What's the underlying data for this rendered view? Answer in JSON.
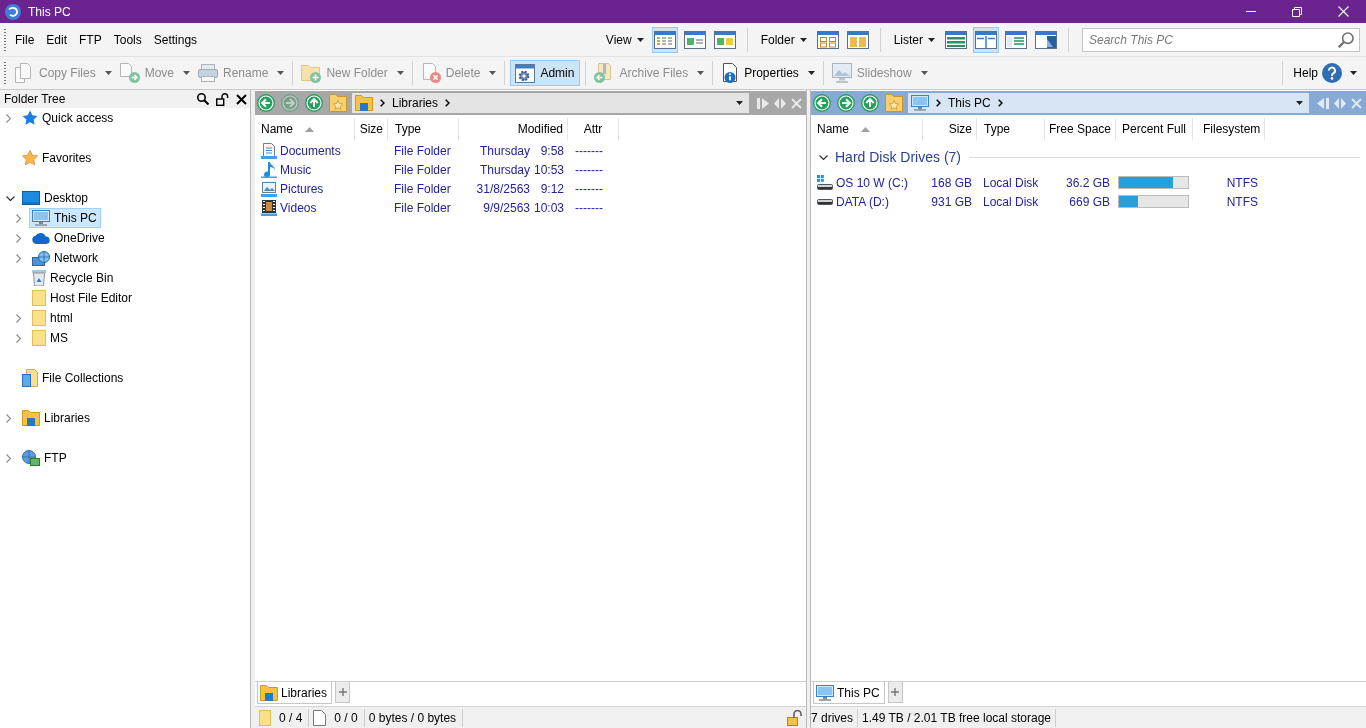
{
  "window": {
    "title": "This PC"
  },
  "menu": [
    {
      "label": "File"
    },
    {
      "label": "Edit"
    },
    {
      "label": "FTP"
    },
    {
      "label": "Tools"
    },
    {
      "label": "Settings"
    }
  ],
  "view_groups": [
    {
      "label": "View",
      "buttons": [
        {
          "kind": "details",
          "selected": true
        },
        {
          "kind": "thumbnails",
          "selected": false
        },
        {
          "kind": "tiles",
          "selected": false
        }
      ]
    },
    {
      "label": "Folder",
      "buttons": [
        {
          "kind": "grid",
          "selected": false
        },
        {
          "kind": "pair",
          "selected": false
        }
      ]
    },
    {
      "label": "Lister",
      "buttons": [
        {
          "kind": "stripes",
          "selected": false
        },
        {
          "kind": "dual",
          "selected": true
        },
        {
          "kind": "tree",
          "selected": false
        },
        {
          "kind": "viewer",
          "selected": false
        }
      ]
    }
  ],
  "search": {
    "placeholder": "Search This PC"
  },
  "toolbar_groups": [
    {
      "buttons": [
        {
          "label": "Copy Files",
          "kind": "copy",
          "disabled": true,
          "on": false,
          "dropdown": true
        },
        {
          "label": "Move",
          "kind": "move",
          "disabled": true,
          "on": false,
          "dropdown": true
        },
        {
          "label": "Rename",
          "kind": "rename",
          "disabled": true,
          "on": false,
          "dropdown": true
        }
      ]
    },
    {
      "buttons": [
        {
          "label": "New Folder",
          "kind": "newfolder",
          "disabled": true,
          "on": false,
          "dropdown": true
        }
      ]
    },
    {
      "buttons": [
        {
          "label": "Delete",
          "kind": "delete",
          "disabled": true,
          "on": false,
          "dropdown": true
        }
      ]
    },
    {
      "buttons": [
        {
          "label": "Admin",
          "kind": "admin",
          "disabled": false,
          "on": true,
          "dropdown": false
        }
      ]
    },
    {
      "buttons": [
        {
          "label": "Archive Files",
          "kind": "archive",
          "disabled": true,
          "on": false,
          "dropdown": true
        }
      ]
    },
    {
      "buttons": [
        {
          "label": "Properties",
          "kind": "properties",
          "disabled": false,
          "on": false,
          "dropdown": true
        }
      ]
    },
    {
      "buttons": [
        {
          "label": "Slideshow",
          "kind": "slideshow",
          "disabled": true,
          "on": false,
          "dropdown": true
        }
      ]
    }
  ],
  "help": {
    "label": "Help"
  },
  "folder_tree": {
    "title": "Folder Tree",
    "items": [
      {
        "label": "Quick access",
        "kind": "pin",
        "selected": false,
        "expanded": false
      },
      {
        "label": "Favorites",
        "kind": "favorites",
        "selected": false
      },
      {
        "label": "Desktop",
        "kind": "desktop",
        "selected": false,
        "expanded": true,
        "children": [
          {
            "label": "This PC",
            "kind": "computer",
            "selected": true,
            "expanded": false
          },
          {
            "label": "OneDrive",
            "kind": "cloud",
            "selected": false,
            "expanded": false
          },
          {
            "label": "Network",
            "kind": "network",
            "selected": false,
            "expanded": false
          },
          {
            "label": "Recycle Bin",
            "kind": "recycle",
            "selected": false
          },
          {
            "label": "Host File Editor",
            "kind": "folder",
            "selected": false
          },
          {
            "label": "html",
            "kind": "folder",
            "selected": false,
            "expanded": false
          },
          {
            "label": "MS",
            "kind": "folder",
            "selected": false,
            "expanded": false
          }
        ]
      },
      {
        "label": "File Collections",
        "kind": "collections",
        "selected": false
      },
      {
        "label": "Libraries",
        "kind": "library",
        "selected": false,
        "expanded": false
      },
      {
        "label": "FTP",
        "kind": "ftp",
        "selected": false,
        "expanded": false
      }
    ]
  },
  "listers": [
    {
      "active": false,
      "nav": [
        {
          "kind": "back",
          "disabled": false
        },
        {
          "kind": "forward",
          "disabled": true
        },
        {
          "kind": "up",
          "disabled": false
        },
        {
          "kind": "favorites",
          "disabled": false
        }
      ],
      "path": {
        "kind": "library",
        "segments": [
          "Libraries"
        ]
      },
      "columns": [
        {
          "label": "Name",
          "kind": "name",
          "sorted": true
        },
        {
          "label": "Size",
          "kind": "size",
          "sorted": false
        },
        {
          "label": "Type",
          "kind": "type",
          "sorted": false
        },
        {
          "label": "Modified",
          "kind": "modified",
          "sorted": false
        },
        {
          "label": "Attr",
          "kind": "attr",
          "sorted": false
        }
      ],
      "rows": [
        {
          "kind": "documents",
          "name": "Documents",
          "type": "File Folder",
          "modified": {
            "date": "Thursday",
            "time": "9:58"
          },
          "attr": "-------"
        },
        {
          "kind": "music",
          "name": "Music",
          "type": "File Folder",
          "modified": {
            "date": "Thursday",
            "time": "10:53"
          },
          "attr": "-------"
        },
        {
          "kind": "pictures",
          "name": "Pictures",
          "type": "File Folder",
          "modified": {
            "date": "31/8/2563",
            "time": "9:12"
          },
          "attr": "-------"
        },
        {
          "kind": "videos",
          "name": "Videos",
          "type": "File Folder",
          "modified": {
            "date": "9/9/2563",
            "time": "10:03"
          },
          "attr": "-------"
        }
      ],
      "tabs": [
        {
          "label": "Libraries",
          "kind": "library",
          "selected": true
        }
      ],
      "status": [
        {
          "kind": "folders",
          "text": "0 / 4"
        },
        {
          "kind": "files",
          "text": "0 / 0"
        },
        {
          "kind": "plain",
          "text": "0 bytes / 0 bytes"
        },
        {
          "kind": "lock"
        }
      ]
    },
    {
      "active": true,
      "nav": [
        {
          "kind": "back",
          "disabled": false
        },
        {
          "kind": "forward",
          "disabled": false
        },
        {
          "kind": "up",
          "disabled": false
        },
        {
          "kind": "favorites",
          "disabled": false
        }
      ],
      "path": {
        "kind": "computer",
        "segments": [
          "This PC"
        ]
      },
      "columns": [
        {
          "label": "Name",
          "kind": "name",
          "sorted": true
        },
        {
          "label": "Size",
          "kind": "size",
          "sorted": false
        },
        {
          "label": "Type",
          "kind": "type",
          "sorted": false
        },
        {
          "label": "Free Space",
          "kind": "free_space",
          "sorted": false
        },
        {
          "label": "Percent Full",
          "kind": "percent_full",
          "sorted": false
        },
        {
          "label": "Filesystem",
          "kind": "filesystem",
          "sorted": false
        }
      ],
      "groups": [
        {
          "label": "Hard Disk Drives (7)",
          "expanded": true,
          "rows": [
            {
              "kind": "system",
              "name": "OS 10 W (C:)",
              "size": "168 GB",
              "type": "Local Disk",
              "free_space": "36.2 GB",
              "percent_full": {
                "level": 0.78
              },
              "filesystem": "NTFS"
            },
            {
              "kind": "drive",
              "name": "DATA (D:)",
              "size": "931 GB",
              "type": "Local Disk",
              "free_space": "669 GB",
              "percent_full": {
                "level": 0.28
              },
              "filesystem": "NTFS"
            }
          ]
        }
      ],
      "tabs": [
        {
          "label": "This PC",
          "kind": "computer",
          "selected": true
        }
      ],
      "status": [
        {
          "kind": "plain",
          "text": "7 drives"
        },
        {
          "kind": "plain",
          "text": "1.49 TB / 2.01 TB free local storage"
        }
      ]
    }
  ]
}
